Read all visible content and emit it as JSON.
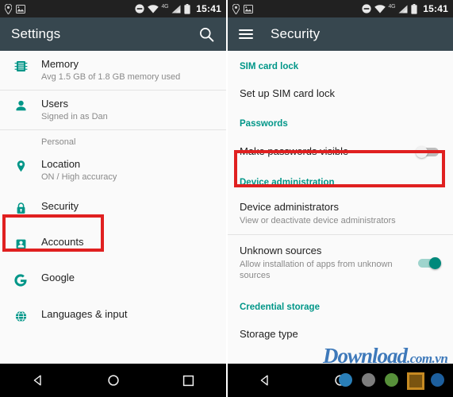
{
  "status_bar": {
    "left_icons": [
      "location-pin-icon",
      "image-icon"
    ],
    "right_icons": [
      "do-not-disturb-icon",
      "wifi-icon",
      "signal-icon",
      "battery-icon"
    ],
    "network_label": "4G",
    "time": "15:41"
  },
  "colors": {
    "accent_teal": "#009688",
    "appbar": "#37474f",
    "statusbar": "#212121",
    "highlight_red": "#e02020",
    "toggle_on": "#00897b",
    "watermark_blue": "#2f6fb5"
  },
  "left_phone": {
    "appbar": {
      "title": "Settings",
      "search_icon": "search-icon"
    },
    "rows": [
      {
        "icon": "memory-chip-icon",
        "title": "Memory",
        "subtitle": "Avg 1.5 GB of 1.8 GB memory used"
      },
      {
        "icon": "person-icon",
        "title": "Users",
        "subtitle": "Signed in as Dan"
      }
    ],
    "section_label": "Personal",
    "personal_rows": [
      {
        "icon": "location-pin-icon",
        "title": "Location",
        "subtitle": "ON / High accuracy"
      },
      {
        "icon": "lock-icon",
        "title": "Security",
        "subtitle": ""
      },
      {
        "icon": "account-box-icon",
        "title": "Accounts",
        "subtitle": ""
      },
      {
        "icon": "google-g-icon",
        "title": "Google",
        "subtitle": ""
      },
      {
        "icon": "globe-icon",
        "title": "Languages & input",
        "subtitle": ""
      }
    ],
    "highlighted_item": "Security",
    "navbar": [
      "back-icon",
      "home-icon",
      "recents-icon"
    ]
  },
  "right_phone": {
    "appbar": {
      "menu_icon": "hamburger-menu-icon",
      "title": "Security"
    },
    "sections": [
      {
        "header": "SIM card lock",
        "items": [
          {
            "title": "Set up SIM card lock",
            "subtitle": "",
            "toggle": null
          }
        ]
      },
      {
        "header": "Passwords",
        "items": [
          {
            "title": "Make passwords visible",
            "subtitle": "",
            "toggle": "off"
          }
        ]
      },
      {
        "header": "Device administration",
        "items": [
          {
            "title": "Device administrators",
            "subtitle": "View or deactivate device administrators",
            "toggle": null
          },
          {
            "title": "Unknown sources",
            "subtitle": "Allow installation of apps from unknown sources",
            "toggle": "on"
          }
        ]
      },
      {
        "header": "Credential storage",
        "items": [
          {
            "title": "Storage type",
            "subtitle": "",
            "toggle": null
          }
        ]
      }
    ],
    "highlighted_item": "Make passwords visible",
    "navbar": [
      "back-icon",
      "home-icon",
      "recents-icon"
    ],
    "navbar_dots": [
      "#2a7fb8",
      "#7d7d7d",
      "#57903a",
      "#1d5f9e",
      "#b8232c"
    ],
    "watermark": {
      "main": "Download",
      "suffix": ".com.vn"
    }
  }
}
